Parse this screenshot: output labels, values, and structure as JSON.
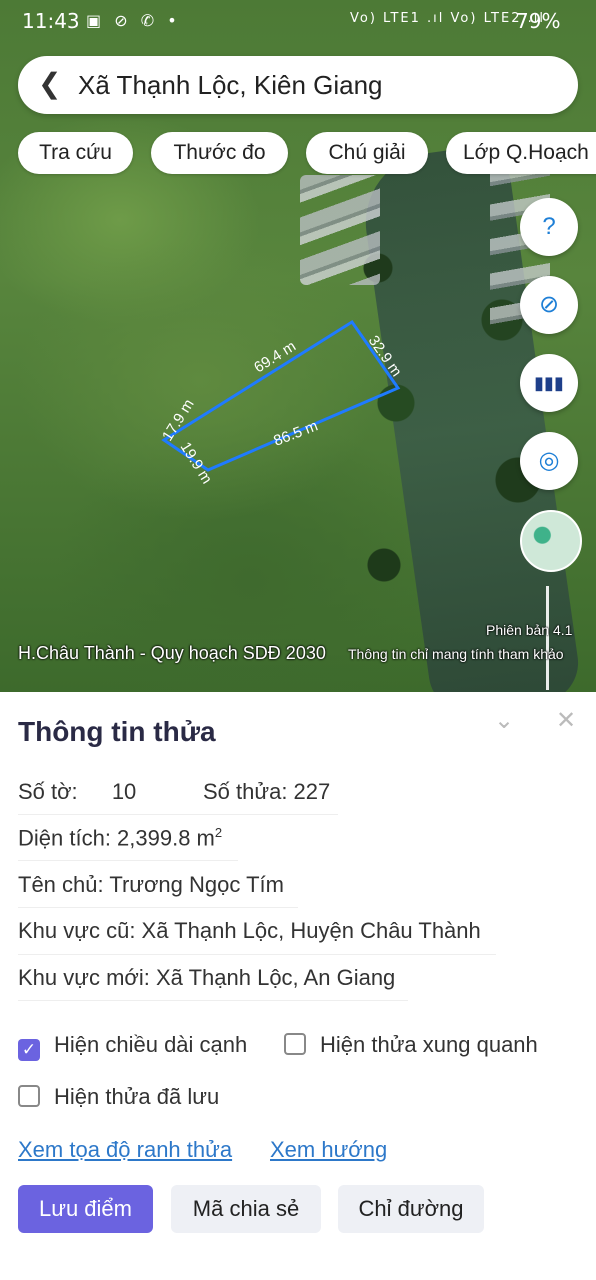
{
  "status_bar": {
    "time": "11:43",
    "left_icons": "▣ ⊘ ✆ •",
    "network": "Vo) LTE1 .ıl Vo) LTE2 .ıl",
    "battery": "79%"
  },
  "search": {
    "back_icon": "chevron-left-icon",
    "title": "Xã Thạnh Lộc, Kiên Giang"
  },
  "chips": [
    "Tra cứu",
    "Thước đo",
    "Chú giải",
    "Lớp Q.Hoạch"
  ],
  "map": {
    "edge_labels": [
      "69.4 m",
      "32.9 m",
      "86.5 m",
      "17.9 m",
      "19.9 m"
    ],
    "version": "Phiên bản 4.1",
    "footer_left": "H.Châu Thành - Quy hoạch SDĐ 2030",
    "footer_note": "Thông tin chỉ mang tính tham khảo",
    "parcel_color": "#1f7bff",
    "buttons": {
      "help": "?",
      "compass": "⊘",
      "barcode": "▮▮▮",
      "locate": "◎"
    }
  },
  "panel": {
    "title": "Thông tin thửa",
    "so_to_label": "Số tờ:",
    "so_to_value": "10",
    "so_thua": "Số thửa: 227",
    "dien_tich": "Diện tích: 2,399.8 m",
    "dien_tich_sup": "2",
    "ten_chu": "Tên chủ: Trương Ngọc Tím",
    "khu_vuc_cu": "Khu vực cũ: Xã Thạnh Lộc, Huyện Châu Thành",
    "khu_vuc_moi": "Khu vực mới: Xã Thạnh Lộc, An Giang",
    "checkboxes": {
      "chieu_dai": {
        "label": "Hiện chiều dài cạnh",
        "checked": true
      },
      "xung_quanh": {
        "label": "Hiện thửa xung quanh",
        "checked": false
      },
      "da_luu": {
        "label": "Hiện thửa đã lưu",
        "checked": false
      }
    },
    "links": {
      "toa_do": "Xem tọa độ ranh thửa",
      "huong": "Xem hướng"
    },
    "buttons": {
      "luu": "Lưu điểm",
      "chia_se": "Mã chia sẻ",
      "chi_duong": "Chỉ đường"
    },
    "accent": "#6b63e0"
  }
}
